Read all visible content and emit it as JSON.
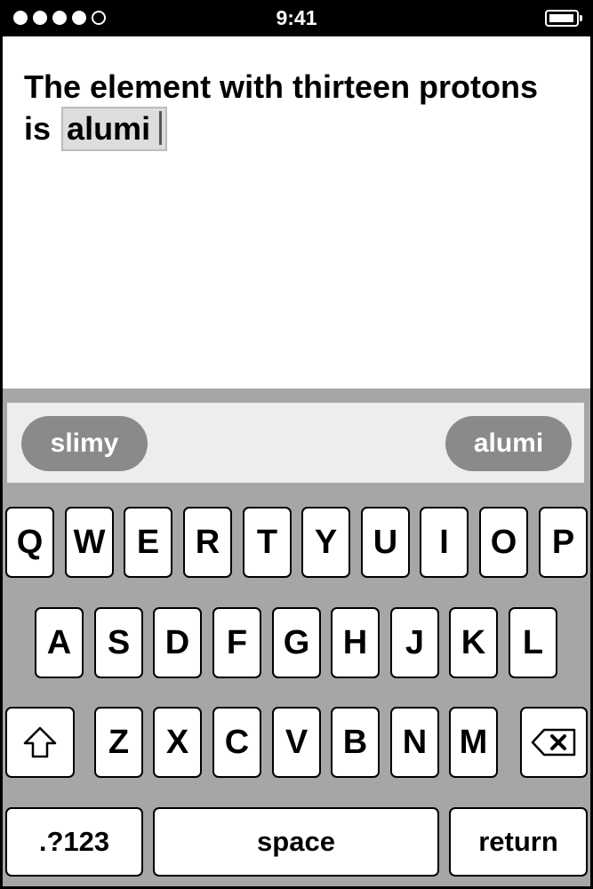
{
  "status": {
    "time": "9:41",
    "signal_icon": "signal-dots-icon",
    "battery_icon": "battery-icon"
  },
  "editor": {
    "line1": "The element with thirteen protons",
    "prefix": "is",
    "typed": "alumi"
  },
  "suggestions": [
    "slimy",
    "alumi"
  ],
  "keyboard": {
    "row1": [
      "Q",
      "W",
      "E",
      "R",
      "T",
      "Y",
      "U",
      "I",
      "O",
      "P"
    ],
    "row2": [
      "A",
      "S",
      "D",
      "F",
      "G",
      "H",
      "J",
      "K",
      "L"
    ],
    "row3": [
      "Z",
      "X",
      "C",
      "V",
      "B",
      "N",
      "M"
    ],
    "shift_icon": "shift-arrow-icon",
    "delete_icon": "backspace-icon",
    "numbers_label": ".?123",
    "space_label": "space",
    "return_label": "return"
  }
}
